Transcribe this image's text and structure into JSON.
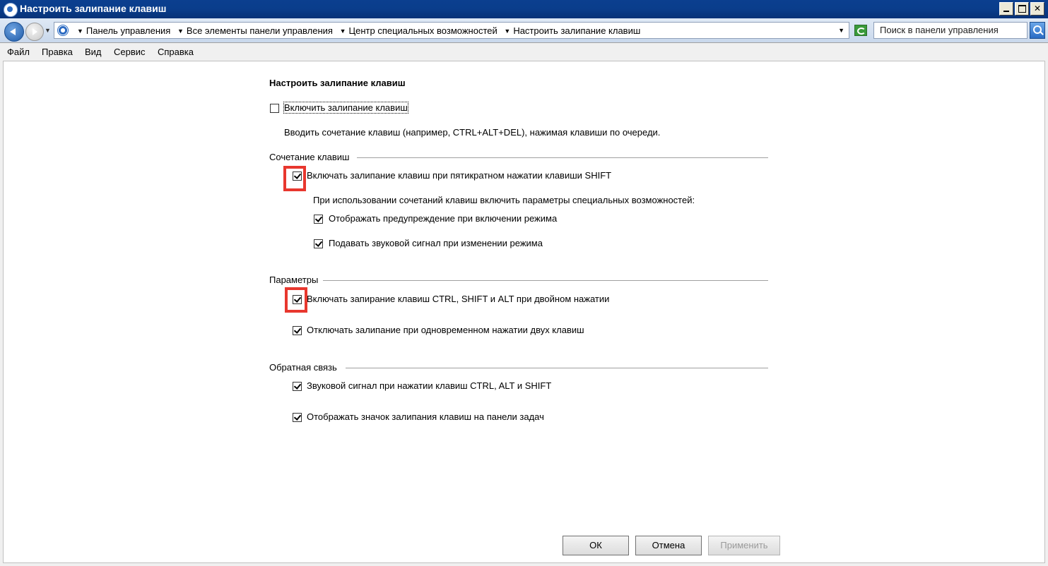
{
  "window": {
    "title": "Настроить залипание клавиш"
  },
  "address": {
    "crumbs": [
      "Панель управления",
      "Все элементы панели управления",
      "Центр специальных возможностей",
      "Настроить залипание клавиш"
    ],
    "search_placeholder": "Поиск в панели управления"
  },
  "menu": {
    "items": [
      "Файл",
      "Правка",
      "Вид",
      "Сервис",
      "Справка"
    ]
  },
  "page": {
    "title": "Настроить залипание клавиш",
    "enable_label": "Включить залипание клавиш",
    "enable_checked": false,
    "enable_description": "Вводить сочетание клавиш (например, CTRL+ALT+DEL), нажимая клавиши по очереди.",
    "shortcut_group": {
      "title": "Сочетание клавиш",
      "shift5_label": "Включать залипание клавиш при пятикратном нажатии клавиши SHIFT",
      "shift5_checked": true,
      "sub_description": "При использовании сочетаний клавиш включить параметры специальных возможностей:",
      "warn_label": "Отображать предупреждение при включении режима",
      "warn_checked": true,
      "sound_label": "Подавать звуковой сигнал при изменении режима",
      "sound_checked": true
    },
    "options_group": {
      "title": "Параметры",
      "lock_label": "Включать запирание клавиш CTRL, SHIFT и ALT при двойном нажатии",
      "lock_checked": true,
      "off_label": "Отключать залипание при одновременном нажатии двух клавиш",
      "off_checked": true
    },
    "feedback_group": {
      "title": "Обратная связь",
      "beep_label": "Звуковой сигнал при нажатии клавиш CTRL, ALT и SHIFT",
      "beep_checked": true,
      "tray_label": "Отображать значок залипания клавиш на панели задач",
      "tray_checked": true
    }
  },
  "buttons": {
    "ok": "ОК",
    "cancel": "Отмена",
    "apply": "Применить"
  },
  "colors": {
    "highlight": "#e8372e",
    "titlebar": "#0a3d8b"
  }
}
